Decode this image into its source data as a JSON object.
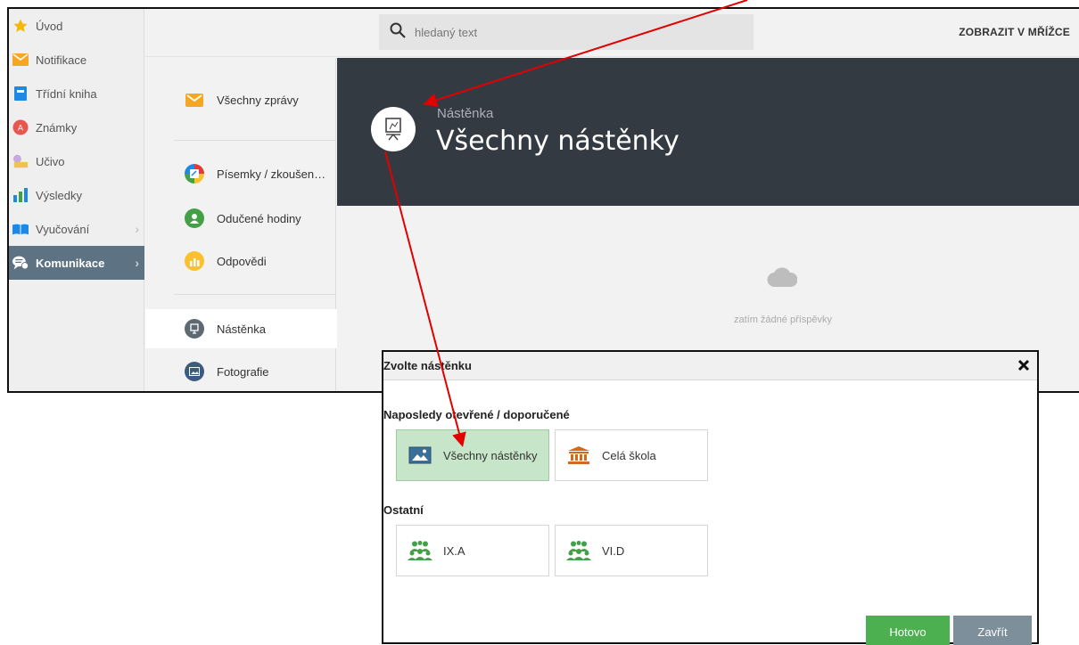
{
  "sidebar": {
    "items": [
      {
        "label": "Úvod",
        "icon": "star-icon"
      },
      {
        "label": "Notifikace",
        "icon": "envelope-icon"
      },
      {
        "label": "Třídní kniha",
        "icon": "book-icon"
      },
      {
        "label": "Známky",
        "icon": "grades-icon"
      },
      {
        "label": "Učivo",
        "icon": "curriculum-icon"
      },
      {
        "label": "Výsledky",
        "icon": "bar-chart-icon"
      },
      {
        "label": "Vyučování",
        "icon": "open-book-icon"
      },
      {
        "label": "Komunikace",
        "icon": "chat-icon",
        "active": true
      }
    ]
  },
  "topbar": {
    "search_placeholder": "hledaný text",
    "grid_link": "ZOBRAZIT V MŘÍŽCE"
  },
  "subnav": {
    "items": [
      {
        "label": "Všechny zprávy",
        "icon": "envelope-icon"
      },
      {
        "label": "Písemky / zkoušen…",
        "icon": "exam-icon"
      },
      {
        "label": "Odučené hodiny",
        "icon": "teacher-icon"
      },
      {
        "label": "Odpovědi",
        "icon": "answers-chart-icon"
      },
      {
        "label": "Nástěnka",
        "icon": "board-icon",
        "selected": true
      },
      {
        "label": "Fotografie",
        "icon": "photo-icon"
      }
    ]
  },
  "hero": {
    "subtitle": "Nástěnka",
    "title": "Všechny nástěnky"
  },
  "content": {
    "empty_text": "zatím žádné příspěvky"
  },
  "modal": {
    "title": "Zvolte nástěnku",
    "recent_label": "Naposledy otevřené / doporučené",
    "recent": [
      {
        "label": "Všechny nástěnky",
        "icon": "picture-icon",
        "selected": true
      },
      {
        "label": "Celá škola",
        "icon": "school-building-icon"
      }
    ],
    "other_label": "Ostatní",
    "other": [
      {
        "label": "IX.A",
        "icon": "group-icon"
      },
      {
        "label": "VI.D",
        "icon": "group-icon"
      }
    ],
    "done_label": "Hotovo",
    "close_label": "Zavřít"
  },
  "colors": {
    "active_sidebar": "#5d7282",
    "hero_background": "#343a42",
    "selected_tile": "#c7e6c9",
    "done_button": "#4caf50",
    "close_button": "#7d8f9a",
    "annotation_arrow": "#e00000"
  }
}
